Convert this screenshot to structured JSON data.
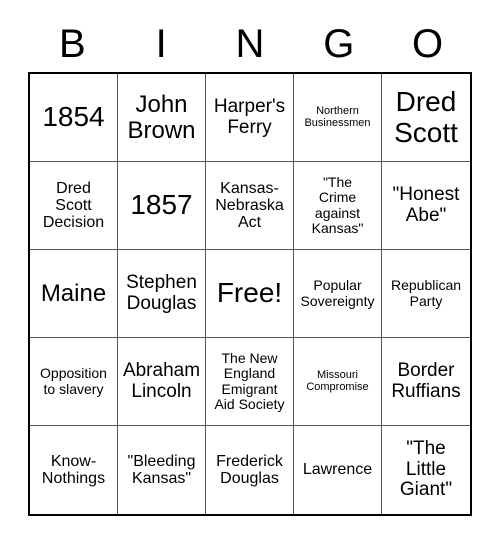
{
  "card": {
    "header_letters": [
      "B",
      "I",
      "N",
      "G",
      "O"
    ],
    "cells": [
      {
        "text": "1854",
        "size": "fs-xxl"
      },
      {
        "text": "John\nBrown",
        "size": "fs-xl"
      },
      {
        "text": "Harper's\nFerry",
        "size": "fs-l"
      },
      {
        "text": "Northern\nBusinessmen",
        "size": "fs-xs"
      },
      {
        "text": "Dred\nScott",
        "size": "fs-xxl"
      },
      {
        "text": "Dred\nScott\nDecision",
        "size": "fs-m"
      },
      {
        "text": "1857",
        "size": "fs-xxl"
      },
      {
        "text": "Kansas-\nNebraska\nAct",
        "size": "fs-m"
      },
      {
        "text": "\"The\nCrime\nagainst\nKansas\"",
        "size": "fs-s"
      },
      {
        "text": "\"Honest\nAbe\"",
        "size": "fs-l"
      },
      {
        "text": "Maine",
        "size": "fs-xl"
      },
      {
        "text": "Stephen\nDouglas",
        "size": "fs-l"
      },
      {
        "text": "Free!",
        "size": "fs-xxl"
      },
      {
        "text": "Popular\nSovereignty",
        "size": "fs-s"
      },
      {
        "text": "Republican\nParty",
        "size": "fs-s"
      },
      {
        "text": "Opposition\nto slavery",
        "size": "fs-s"
      },
      {
        "text": "Abraham\nLincoln",
        "size": "fs-l"
      },
      {
        "text": "The New\nEngland\nEmigrant\nAid Society",
        "size": "fs-s"
      },
      {
        "text": "Missouri\nCompromise",
        "size": "fs-xs"
      },
      {
        "text": "Border\nRuffians",
        "size": "fs-l"
      },
      {
        "text": "Know-\nNothings",
        "size": "fs-m"
      },
      {
        "text": "\"Bleeding\nKansas\"",
        "size": "fs-m"
      },
      {
        "text": "Frederick\nDouglas",
        "size": "fs-m"
      },
      {
        "text": "Lawrence",
        "size": "fs-m"
      },
      {
        "text": "\"The\nLittle\nGiant\"",
        "size": "fs-l"
      }
    ]
  }
}
